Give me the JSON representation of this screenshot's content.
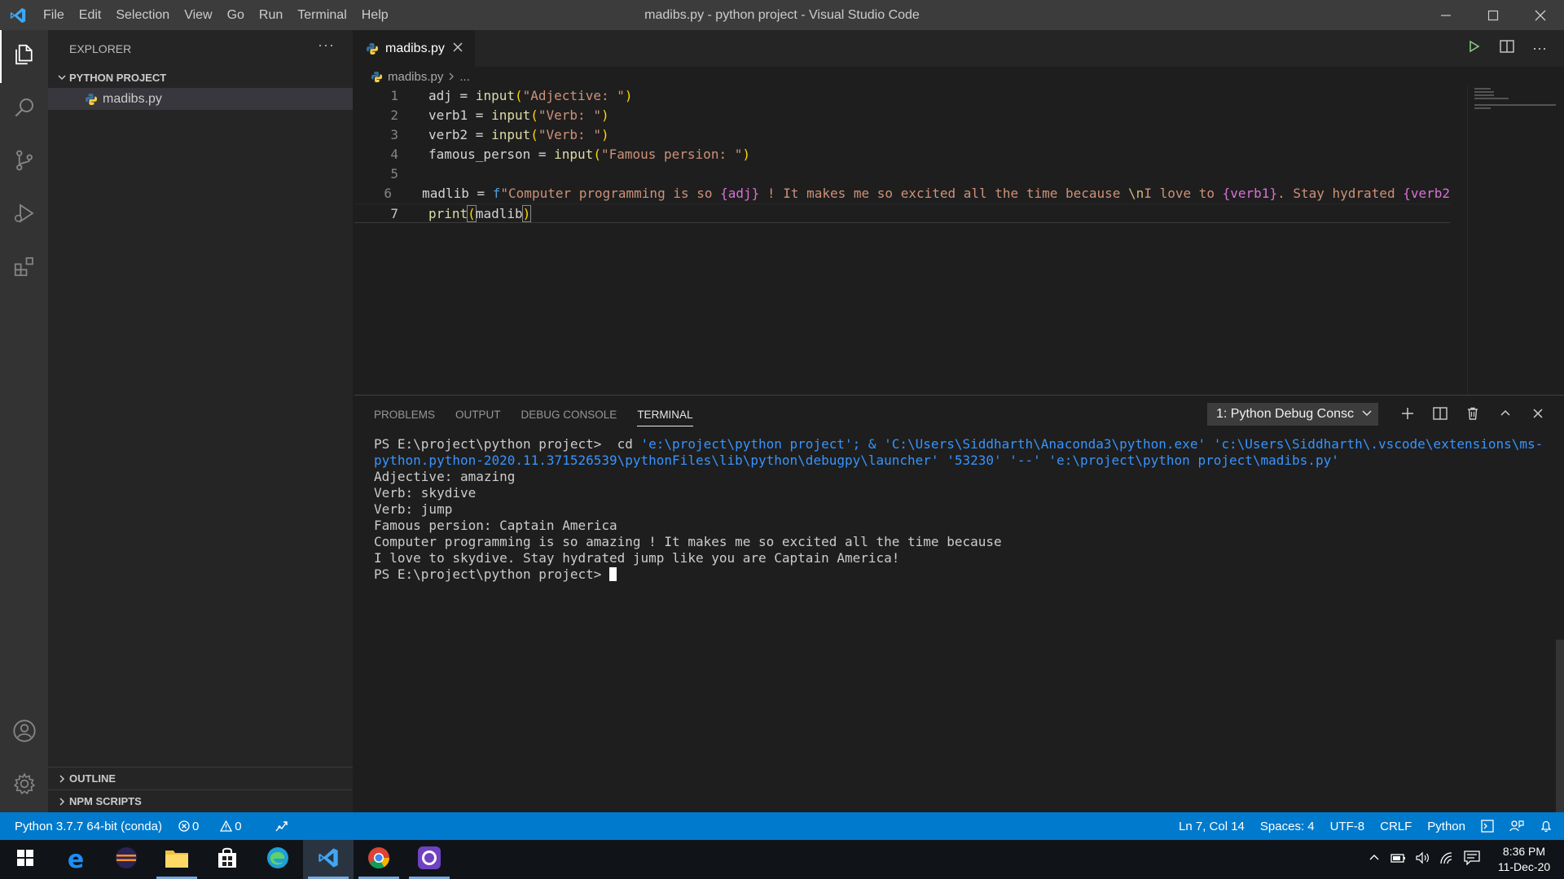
{
  "window": {
    "title": "madibs.py - python project - Visual Studio Code",
    "menu": [
      "File",
      "Edit",
      "Selection",
      "View",
      "Go",
      "Run",
      "Terminal",
      "Help"
    ]
  },
  "sidebar": {
    "header": "EXPLORER",
    "project": "PYTHON PROJECT",
    "files": [
      "madibs.py"
    ],
    "outline": "OUTLINE",
    "npm": "NPM SCRIPTS"
  },
  "editor": {
    "tab": "madibs.py",
    "breadcrumb_file": "madibs.py",
    "breadcrumb_more": "...",
    "line_numbers": [
      "1",
      "2",
      "3",
      "4",
      "5",
      "6",
      "7"
    ],
    "code": {
      "l1": {
        "var": "adj",
        "op": " = ",
        "fn": "input",
        "arg": "\"Adjective: \""
      },
      "l2": {
        "var": "verb1",
        "op": " = ",
        "fn": "input",
        "arg": "\"Verb: \""
      },
      "l3": {
        "var": "verb2",
        "op": " = ",
        "fn": "input",
        "arg": "\"Verb: \""
      },
      "l4": {
        "var": "famous_person",
        "op": " = ",
        "fn": "input",
        "arg": "\"Famous persion: \""
      },
      "l6": {
        "var": "madlib",
        "op": " = ",
        "prefix": "f",
        "s1": "\"Computer programming is so ",
        "p1": "{adj}",
        "s2": " ! It makes me so excited all the time because ",
        "esc": "\\n",
        "s3": "I love to ",
        "p2": "{verb1}",
        "s4": ". Stay hydrated ",
        "p3": "{verb2"
      },
      "l7": {
        "fn": "print",
        "open": "(",
        "arg": "madlib",
        "close": ")"
      }
    }
  },
  "panel": {
    "tabs": [
      "PROBLEMS",
      "OUTPUT",
      "DEBUG CONSOLE",
      "TERMINAL"
    ],
    "active_tab": "TERMINAL",
    "terminal_select": "1: Python Debug Consc",
    "terminal": {
      "prompt": "PS E:\\project\\python project> ",
      "cmd_prefix": " cd ",
      "cmd_rest": "'e:\\project\\python project'; & 'C:\\Users\\Siddharth\\Anaconda3\\python.exe' 'c:\\Users\\Siddharth\\.vscode\\extensions\\ms-python.python-2020.11.371526539\\pythonFiles\\lib\\python\\debugpy\\launcher' '53230' '--' 'e:\\project\\python project\\madibs.py'",
      "out1": "Adjective: amazing",
      "out2": "Verb: skydive",
      "out3": "Verb: jump",
      "out4": "Famous persion: Captain America",
      "out5": "Computer programming is so amazing ! It makes me so excited all the time because",
      "out6": "I love to skydive. Stay hydrated jump like you are Captain America!",
      "prompt_end": "PS E:\\project\\python project> "
    }
  },
  "status": {
    "interpreter": "Python 3.7.7 64-bit (conda)",
    "errors": "0",
    "warnings": "0",
    "position": "Ln 7, Col 14",
    "spaces": "Spaces: 4",
    "encoding": "UTF-8",
    "eol": "CRLF",
    "language": "Python"
  },
  "taskbar": {
    "time": "8:36 PM",
    "date": "11-Dec-20"
  },
  "colors": {
    "accent": "#007acc",
    "titlebar": "#3c3c3c",
    "activitybar": "#333333",
    "sidebar": "#252526",
    "editor": "#1e1e1e"
  }
}
